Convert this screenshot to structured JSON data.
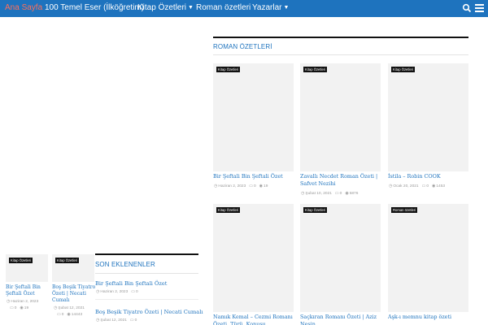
{
  "nav": {
    "items": [
      "Ana Sayfa",
      "100 Temel Eser (İlköğretim)",
      "Kitap Özetleri",
      "Roman özetleri",
      "Yazarlar"
    ]
  },
  "colors": {
    "accent": "#1e73be",
    "active": "#ff6f59",
    "badge": "#111111"
  },
  "roman_section": {
    "title": "ROMAN ÖZETLERİ",
    "cards": [
      {
        "badge": "Kitap Özetleri",
        "title": "Bir Şeftali Bin Şeftali Özet",
        "date": "Haziran 2, 2023",
        "comments": "0",
        "views": "19"
      },
      {
        "badge": "Kitap Özetleri",
        "title": "Zavallı Necdet Roman Özeti | Safvet Nezihi",
        "date": "Şubat 10, 2021",
        "comments": "0",
        "views": "5876"
      },
      {
        "badge": "Kitap Özetleri",
        "title": "İstila – Robin COOK",
        "date": "Ocak 20, 2021",
        "comments": "0",
        "views": "1453"
      },
      {
        "badge": "Kitap Özetleri",
        "title": "Namık Kemal – Cezmi Romanı Özeti, Türü, Konusu",
        "date": "",
        "comments": "",
        "views": ""
      },
      {
        "badge": "Kitap Özetleri",
        "title": "Saçkıran Romanı Özeti | Aziz Nesin",
        "date": "",
        "comments": "",
        "views": ""
      },
      {
        "badge": "Roman özetleri",
        "title": "Aşk-ı memnu kitap özeti",
        "date": "",
        "comments": "",
        "views": ""
      }
    ]
  },
  "small_cards": [
    {
      "badge": "Kitap Özetleri",
      "title": "Bir Şeftali Bin Şeftali Özet",
      "date": "Haziran 2, 2023",
      "comments": "0",
      "views": "19"
    },
    {
      "badge": "Kitap Özetleri",
      "title": "Boş Beşik Tiyatro Özeti | Necati Cumalı",
      "date": "Şubat 12, 2021",
      "comments": "0",
      "views": "14443"
    }
  ],
  "son_eklenenler": {
    "title": "SON EKLENENLER",
    "items": [
      {
        "title": "Bir Şeftali Bin Şeftali Özet",
        "date": "Haziran 2, 2023",
        "comments": "0"
      },
      {
        "title": "Boş Beşik Tiyatro Özeti | Necati Cumalı",
        "date": "Şubat 12, 2021",
        "comments": "0"
      }
    ]
  },
  "icons": {
    "search": "search-icon",
    "menu": "hamburger-menu-icon",
    "clock": "clock-icon",
    "comment": "comment-icon",
    "eye": "eye-icon"
  }
}
